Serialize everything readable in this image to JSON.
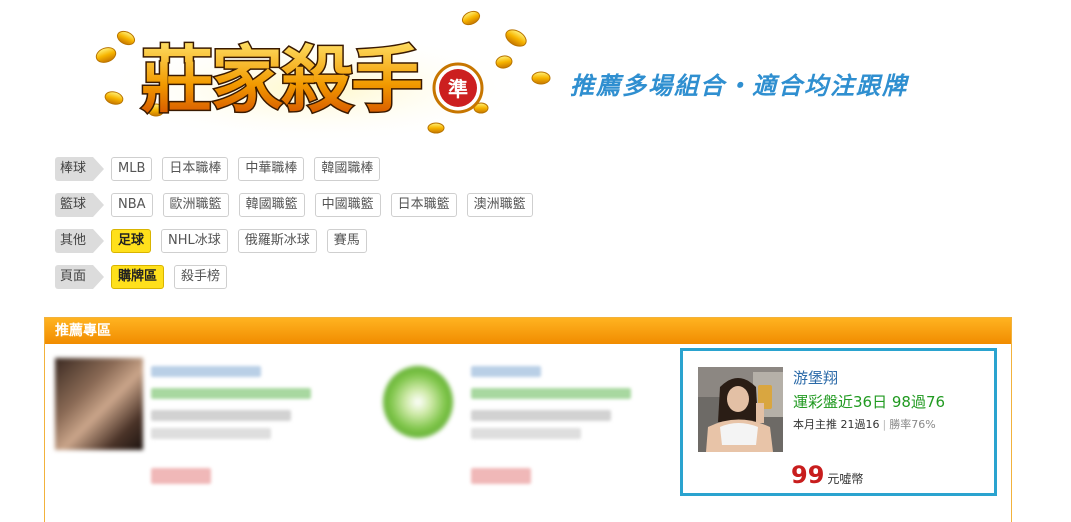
{
  "header": {
    "logo_text": "莊家殺手",
    "logo_badge": "準",
    "slogan": "推薦多場組合・適合均注跟牌"
  },
  "filters": [
    {
      "category": "棒球",
      "options": [
        {
          "label": "MLB",
          "active": false
        },
        {
          "label": "日本職棒",
          "active": false
        },
        {
          "label": "中華職棒",
          "active": false
        },
        {
          "label": "韓國職棒",
          "active": false
        }
      ]
    },
    {
      "category": "籃球",
      "options": [
        {
          "label": "NBA",
          "active": false
        },
        {
          "label": "歐洲職籃",
          "active": false
        },
        {
          "label": "韓國職籃",
          "active": false
        },
        {
          "label": "中國職籃",
          "active": false
        },
        {
          "label": "日本職籃",
          "active": false
        },
        {
          "label": "澳洲職籃",
          "active": false
        }
      ]
    },
    {
      "category": "其他",
      "options": [
        {
          "label": "足球",
          "active": true
        },
        {
          "label": "NHL冰球",
          "active": false
        },
        {
          "label": "俄羅斯冰球",
          "active": false
        },
        {
          "label": "賽馬",
          "active": false
        }
      ]
    },
    {
      "category": "頁面",
      "options": [
        {
          "label": "購牌區",
          "active": true
        },
        {
          "label": "殺手榜",
          "active": false
        }
      ]
    }
  ],
  "panel": {
    "title": "推薦專區",
    "featured": {
      "name": "游堡翔",
      "streak": "運彩盤近36日 98過76",
      "monthly": "本月主推 21過16",
      "win_rate": "勝率76%",
      "price": "99",
      "price_unit": "元噓幣"
    }
  },
  "colors": {
    "accent_orange": "#f39800",
    "active_chip": "#ffe01b",
    "featured_border": "#2aa3cf",
    "price_red": "#c81d1d",
    "name_blue": "#2b6aa8",
    "streak_green": "#219a21",
    "slogan_blue": "#2f8fd0"
  }
}
